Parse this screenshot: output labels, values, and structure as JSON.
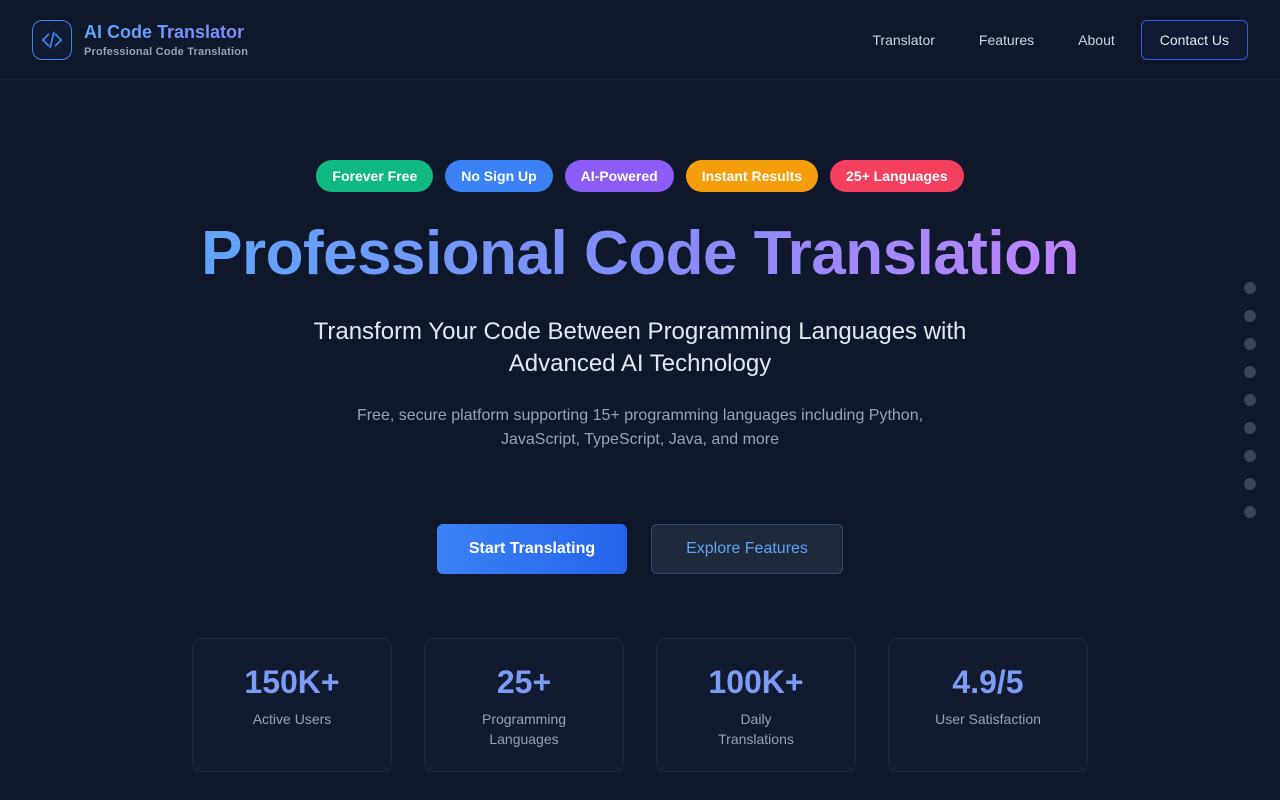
{
  "header": {
    "brand_title": "AI Code Translator",
    "brand_subtitle": "Professional Code Translation",
    "nav": [
      "Translator",
      "Features",
      "About"
    ],
    "contact_label": "Contact Us"
  },
  "badges": [
    {
      "label": "Forever Free",
      "color": "#10b981"
    },
    {
      "label": "No Sign Up",
      "color": "#3b82f6"
    },
    {
      "label": "AI-Powered",
      "color": "#8b5cf6"
    },
    {
      "label": "Instant Results",
      "color": "#f59e0b"
    },
    {
      "label": "25+ Languages",
      "color": "#f43f5e"
    }
  ],
  "hero": {
    "title": "Professional Code Translation",
    "subtitle": "Transform Your Code Between Programming Languages with Advanced AI Technology",
    "description": "Free, secure platform supporting 15+ programming languages including Python, JavaScript, TypeScript, Java, and more"
  },
  "cta": {
    "primary_label": "Start Translating",
    "secondary_label": "Explore Features"
  },
  "stats": [
    {
      "value": "150K+",
      "label": "Active Users"
    },
    {
      "value": "25+",
      "label": "Programming Languages"
    },
    {
      "value": "100K+",
      "label": "Daily Translations"
    },
    {
      "value": "4.9/5",
      "label": "User Satisfaction"
    }
  ],
  "icons": {
    "logo": "code-brackets-icon"
  },
  "colors": {
    "background": "#0f172a",
    "accent": "#3b82f6"
  }
}
